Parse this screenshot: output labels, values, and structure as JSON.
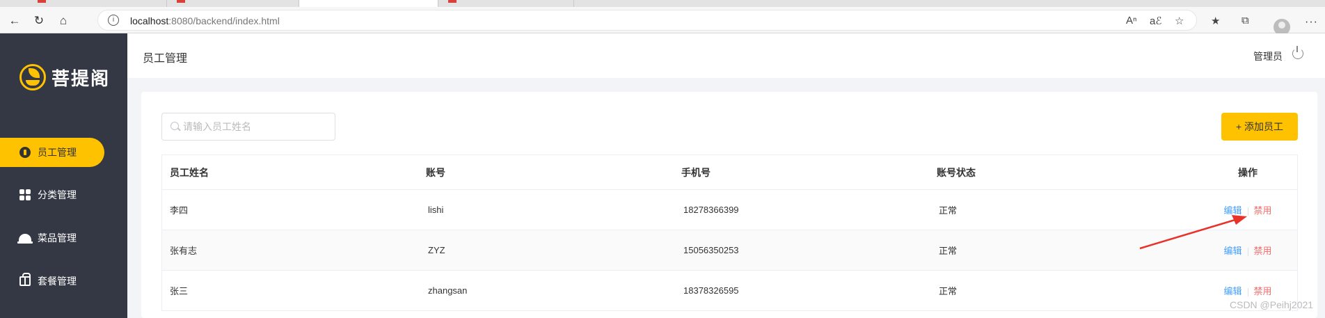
{
  "browser": {
    "url_host": "localhost",
    "url_rest": ":8080/backend/index.html",
    "icon_colors": {
      "toolbar": "#333333",
      "favicon": "#d9403a"
    }
  },
  "sidebar": {
    "logo_text": "菩提阁",
    "brand_color": "#ffc200",
    "items": [
      {
        "label": "员工管理",
        "icon": "user-badge-icon",
        "active": true
      },
      {
        "label": "分类管理",
        "icon": "grid-icon",
        "active": false
      },
      {
        "label": "菜品管理",
        "icon": "cloche-icon",
        "active": false
      },
      {
        "label": "套餐管理",
        "icon": "gift-icon",
        "active": false
      }
    ]
  },
  "header": {
    "title": "员工管理",
    "user": "管理员"
  },
  "toolbar": {
    "search_placeholder": "请输入员工姓名",
    "add_label": "+ 添加员工"
  },
  "table": {
    "columns": [
      "员工姓名",
      "账号",
      "手机号",
      "账号状态",
      "操作"
    ],
    "rows": [
      {
        "name": "李四",
        "account": "lishi",
        "phone": "18278366399",
        "status": "正常",
        "edit": "编辑",
        "disable": "禁用"
      },
      {
        "name": "张有志",
        "account": "ZYZ",
        "phone": "15056350253",
        "status": "正常",
        "edit": "编辑",
        "disable": "禁用"
      },
      {
        "name": "张三",
        "account": "zhangsan",
        "phone": "18378326595",
        "status": "正常",
        "edit": "编辑",
        "disable": "禁用"
      }
    ]
  },
  "watermark": "CSDN @Peihj2021",
  "annotation_color": "#e8322a"
}
